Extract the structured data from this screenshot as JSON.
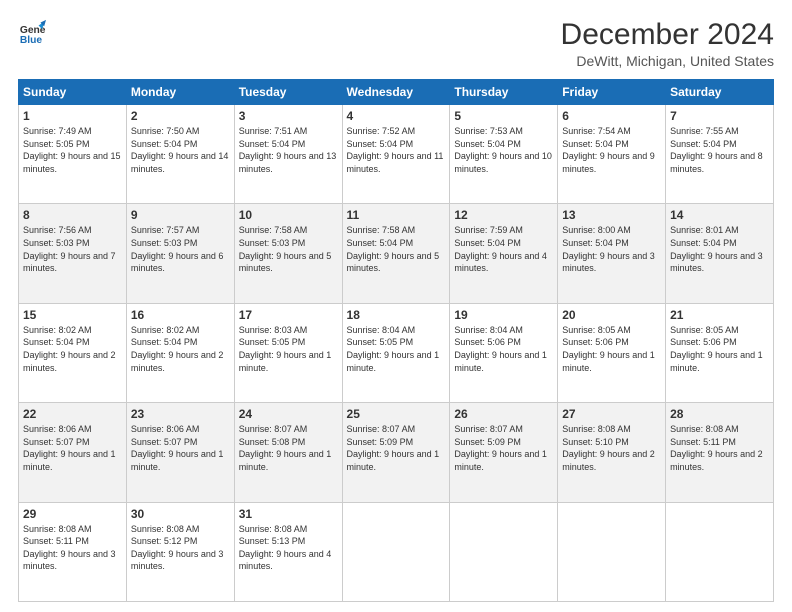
{
  "header": {
    "logo_line1": "General",
    "logo_line2": "Blue",
    "title": "December 2024",
    "subtitle": "DeWitt, Michigan, United States"
  },
  "days_of_week": [
    "Sunday",
    "Monday",
    "Tuesday",
    "Wednesday",
    "Thursday",
    "Friday",
    "Saturday"
  ],
  "weeks": [
    [
      {
        "day": "1",
        "sunrise": "7:49 AM",
        "sunset": "5:05 PM",
        "daylight": "9 hours and 15 minutes."
      },
      {
        "day": "2",
        "sunrise": "7:50 AM",
        "sunset": "5:04 PM",
        "daylight": "9 hours and 14 minutes."
      },
      {
        "day": "3",
        "sunrise": "7:51 AM",
        "sunset": "5:04 PM",
        "daylight": "9 hours and 13 minutes."
      },
      {
        "day": "4",
        "sunrise": "7:52 AM",
        "sunset": "5:04 PM",
        "daylight": "9 hours and 11 minutes."
      },
      {
        "day": "5",
        "sunrise": "7:53 AM",
        "sunset": "5:04 PM",
        "daylight": "9 hours and 10 minutes."
      },
      {
        "day": "6",
        "sunrise": "7:54 AM",
        "sunset": "5:04 PM",
        "daylight": "9 hours and 9 minutes."
      },
      {
        "day": "7",
        "sunrise": "7:55 AM",
        "sunset": "5:04 PM",
        "daylight": "9 hours and 8 minutes."
      }
    ],
    [
      {
        "day": "8",
        "sunrise": "7:56 AM",
        "sunset": "5:03 PM",
        "daylight": "9 hours and 7 minutes."
      },
      {
        "day": "9",
        "sunrise": "7:57 AM",
        "sunset": "5:03 PM",
        "daylight": "9 hours and 6 minutes."
      },
      {
        "day": "10",
        "sunrise": "7:58 AM",
        "sunset": "5:03 PM",
        "daylight": "9 hours and 5 minutes."
      },
      {
        "day": "11",
        "sunrise": "7:58 AM",
        "sunset": "5:04 PM",
        "daylight": "9 hours and 5 minutes."
      },
      {
        "day": "12",
        "sunrise": "7:59 AM",
        "sunset": "5:04 PM",
        "daylight": "9 hours and 4 minutes."
      },
      {
        "day": "13",
        "sunrise": "8:00 AM",
        "sunset": "5:04 PM",
        "daylight": "9 hours and 3 minutes."
      },
      {
        "day": "14",
        "sunrise": "8:01 AM",
        "sunset": "5:04 PM",
        "daylight": "9 hours and 3 minutes."
      }
    ],
    [
      {
        "day": "15",
        "sunrise": "8:02 AM",
        "sunset": "5:04 PM",
        "daylight": "9 hours and 2 minutes."
      },
      {
        "day": "16",
        "sunrise": "8:02 AM",
        "sunset": "5:04 PM",
        "daylight": "9 hours and 2 minutes."
      },
      {
        "day": "17",
        "sunrise": "8:03 AM",
        "sunset": "5:05 PM",
        "daylight": "9 hours and 1 minute."
      },
      {
        "day": "18",
        "sunrise": "8:04 AM",
        "sunset": "5:05 PM",
        "daylight": "9 hours and 1 minute."
      },
      {
        "day": "19",
        "sunrise": "8:04 AM",
        "sunset": "5:06 PM",
        "daylight": "9 hours and 1 minute."
      },
      {
        "day": "20",
        "sunrise": "8:05 AM",
        "sunset": "5:06 PM",
        "daylight": "9 hours and 1 minute."
      },
      {
        "day": "21",
        "sunrise": "8:05 AM",
        "sunset": "5:06 PM",
        "daylight": "9 hours and 1 minute."
      }
    ],
    [
      {
        "day": "22",
        "sunrise": "8:06 AM",
        "sunset": "5:07 PM",
        "daylight": "9 hours and 1 minute."
      },
      {
        "day": "23",
        "sunrise": "8:06 AM",
        "sunset": "5:07 PM",
        "daylight": "9 hours and 1 minute."
      },
      {
        "day": "24",
        "sunrise": "8:07 AM",
        "sunset": "5:08 PM",
        "daylight": "9 hours and 1 minute."
      },
      {
        "day": "25",
        "sunrise": "8:07 AM",
        "sunset": "5:09 PM",
        "daylight": "9 hours and 1 minute."
      },
      {
        "day": "26",
        "sunrise": "8:07 AM",
        "sunset": "5:09 PM",
        "daylight": "9 hours and 1 minute."
      },
      {
        "day": "27",
        "sunrise": "8:08 AM",
        "sunset": "5:10 PM",
        "daylight": "9 hours and 2 minutes."
      },
      {
        "day": "28",
        "sunrise": "8:08 AM",
        "sunset": "5:11 PM",
        "daylight": "9 hours and 2 minutes."
      }
    ],
    [
      {
        "day": "29",
        "sunrise": "8:08 AM",
        "sunset": "5:11 PM",
        "daylight": "9 hours and 3 minutes."
      },
      {
        "day": "30",
        "sunrise": "8:08 AM",
        "sunset": "5:12 PM",
        "daylight": "9 hours and 3 minutes."
      },
      {
        "day": "31",
        "sunrise": "8:08 AM",
        "sunset": "5:13 PM",
        "daylight": "9 hours and 4 minutes."
      },
      null,
      null,
      null,
      null
    ]
  ]
}
